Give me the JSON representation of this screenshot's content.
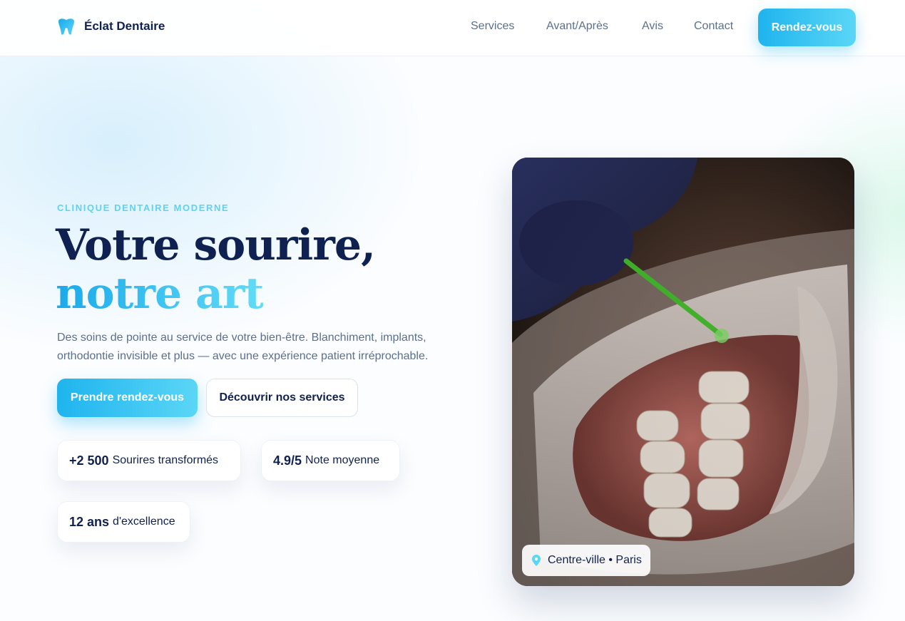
{
  "brand": {
    "name": "Éclat Dentaire",
    "accent": "#1fb4ee",
    "dark": "#0f2151"
  },
  "nav": {
    "links": [
      "Services",
      "Avant/Après",
      "Avis",
      "Contact"
    ],
    "cta": "Rendez-vous"
  },
  "hero": {
    "eyebrow": "CLINIQUE DENTAIRE MODERNE",
    "headline_main": "Votre sourire, ",
    "headline_accent": "notre art",
    "subtitle": "Des soins de pointe au service de votre bien-être. Blanchiment, implants, orthodontie invisible et plus — avec une expérience patient irréprochable.",
    "primary_button": "Prendre rendez-vous",
    "secondary_button": "Découvrir nos services",
    "stats": [
      {
        "value": "+2 500",
        "label": "Sourires transformés"
      },
      {
        "value": "4.9/5",
        "label": "Note moyenne"
      },
      {
        "value": "12 ans",
        "label": "d'excellence"
      }
    ],
    "location": "Centre-ville • Paris",
    "icons": {
      "brand": "tooth-icon",
      "location": "map-pin-icon"
    }
  }
}
